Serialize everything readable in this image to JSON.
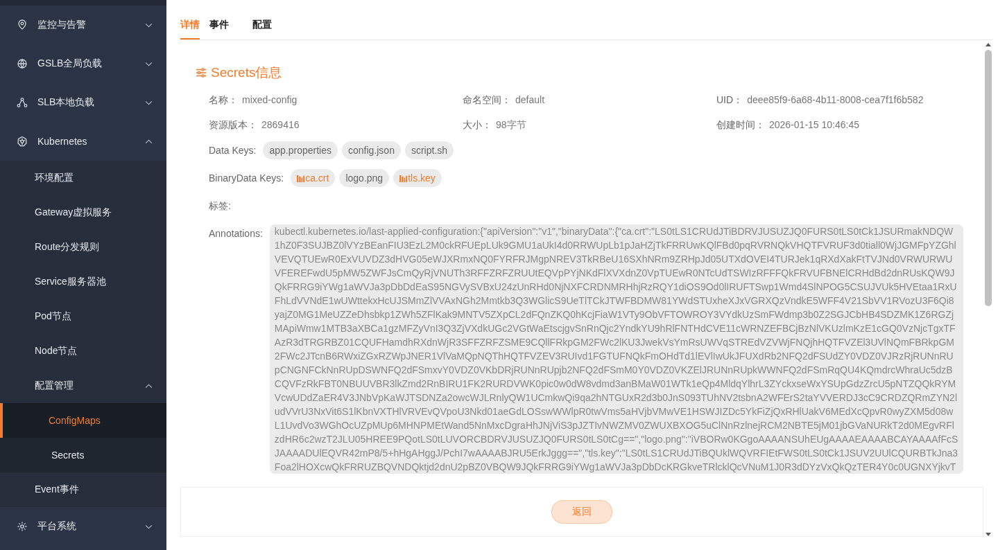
{
  "sidebar": {
    "items": [
      {
        "label": "监控与告警",
        "expanded": false,
        "selected": false
      },
      {
        "label": "GSLB全局负载",
        "expanded": false,
        "selected": false
      },
      {
        "label": "SLB本地负载",
        "expanded": false,
        "selected": false
      },
      {
        "label": "Kubernetes",
        "expanded": true,
        "selected": false,
        "children": [
          {
            "label": "环境配置",
            "selected": false
          },
          {
            "label": "Gateway虚拟服务",
            "selected": false
          },
          {
            "label": "Route分发规则",
            "selected": false
          },
          {
            "label": "Service服务器池",
            "selected": false
          },
          {
            "label": "Pod节点",
            "selected": false
          },
          {
            "label": "Node节点",
            "selected": false
          },
          {
            "label": "配置管理",
            "expanded": true,
            "selected": false,
            "children": [
              {
                "label": "ConfigMaps",
                "selected": true
              },
              {
                "label": "Secrets",
                "selected": false
              }
            ]
          },
          {
            "label": "Event事件",
            "selected": false
          }
        ]
      },
      {
        "label": "平台系统",
        "expanded": false,
        "selected": false
      }
    ]
  },
  "tabs": [
    {
      "label": "详情",
      "selected": true
    },
    {
      "label": "事件",
      "selected": false
    },
    {
      "label": "配置",
      "selected": false
    }
  ],
  "section_title": "Secrets信息",
  "fields": [
    {
      "label": "名称：",
      "value": "mixed-config"
    },
    {
      "label": "命名空间：",
      "value": "default"
    },
    {
      "label": "UID：",
      "value": "deee85f9-6a68-4b11-8008-cea7f1f6b582"
    },
    {
      "label": "资源版本：",
      "value": "2869416"
    },
    {
      "label": "大小：",
      "value": "98字节"
    },
    {
      "label": "创建时间：",
      "value": "2026-01-15 10:46:45"
    }
  ],
  "data_keys": {
    "label": "Data Keys:",
    "tags": [
      {
        "label": "app.properties",
        "kind": "plain"
      },
      {
        "label": "config.json",
        "kind": "plain"
      },
      {
        "label": "script.sh",
        "kind": "plain"
      }
    ]
  },
  "binary_data_keys": {
    "label": "BinaryData Keys:",
    "tags": [
      {
        "label": "ca.crt",
        "kind": "binary"
      },
      {
        "label": "logo.png",
        "kind": "plain"
      },
      {
        "label": "tls.key",
        "kind": "binary"
      }
    ]
  },
  "labels": {
    "label": "标签:"
  },
  "annotations": {
    "label": "Annotations:",
    "value": "kubectl.kubernetes.io/last-applied-configuration:{\"apiVersion\":\"v1\",\"binaryData\":{\"ca.crt\":\"LS0tLS1CRUdJTiBDRVJUSUZJQ0FURS0tLS0tCk1JSURmakNDQW1hZ0F3SUJBZ0lVYzBEanFIU3EzL2M0ckRFUEpLUk9GMU1aUkI4d0RRWUpLb1pJaHZjTkFRRUwKQlFBd0pqRVRNQkVHQTFVRUF3d0tiall0WjJGMFpYZGhlVEVQTUEwR0ExVUVDZ3dHVG05eWJXRmxNQ0FYRFRJMgpNREV3TkRBeU16SXhNRm9ZRHpJd05UTXdOVEI4TURJek1qRXdXakFtTVJNd0VRWURWUVFEREFwdU5pMW5ZWFJsCmQyRjVNUTh3RFFZRFZRUUtEQVpPYjNKdFlXVXdnZ0VpTUEwR0NTcUdTSWIzRFFFQkFRVUFBNElCRHdBd2dnRUsKQW9JQkFRRG9iYWg1aWVJa3pDbDdEaS95NGVySVBxU24zUnRHd0NjNXFCRDNMRHhjRzRQY1diOS9Od0lIRUFTSwp1Wmd4SlNPOG5CSUJVUk5HVEtaa1RxUFhLdVVNdE1wUWttekxHcUJSMmZlVVAxNGh2Mmtkb3Q3WGlicS9UeTlTCkJTWFBDMW81YWdSTUxheXJxVGRXQzVndkE5WFF4V21SbVV1RVozU3F6Qi8yajZ0MG1MeUZZeDhsbkp1ZWh5ZFlKak9MNTV5ZXpCL2dFQnZKQ0hKcjFiaW1VTy9ObVFTOWROY3VYdkUzSmFWdmp3b0Z2SGJCbHB4SDZMK1Z6RGZjMApiWmw1MTB3aXBCa1gzMFZyVnI3Q3ZjVXdkUGc2VGtWaEtscjgvSnRnQjc2YndkYU9hRlFNTHdCVE11cWRNZEFBCjBzNlVKUzlmKzE1cGQ0VzNjcTgxTFAzR3dTRGRBZ01CQUFHamdhRXdnWjR3SFFZRFZSME9CQllFRkpGM2FWc2lKU3JwekVsYmRsUWVqSTREdVZVWjFNQjhHQTFVZEl3UVlNQmFBRkpGM2FWc2JTcnB6RWxiZGxRZWpJNER1VlVaMQpNQThHQTFVZEV3RUIvd1FGTUFNQkFmOHdTd1lEVlIwUkJFUXdRb2NFQ2dFSUdZY0VDZ0VJRzRjRUNnRUpCNGNFCkNnRUpDSWNFQ2dFSmxvY0VDZ0VKbDRjRUNnRUpjb2NFQ2dFSmM0Y0VDZ0VKZElJRUNnRUpkWWNFQ2dFSmRqQU4KQmdrcWhraUc5dzBCQVFzRkFBT0NBUUVBR3lkZmd2RnBIRU1FK2RURDVWK0pic0w0dW8vdmd3anBMaW01WTk1eQp4MldqYlhrL3ZYckxseWxYSUpGdzZrcU5pNTZQQkRYMVcwUDdZaER4V3JNbVpKaWJTSDNZa2owcWJLRnlyQW1UCmkwQi9qa2hNTGUxR2d3b0JnS093TUhNV2tsbnA2WFErS2taYVVERDJ3cC9CRDZQRmZYN2ludVVrU3NxVit6S1lKbnVXTHlVRVEvQVpoU3Nkd01aeGdLOSswWWlpR0twVms5aHVjbVMwVE1HSWJIZDc5YkFiZjQxRHlUakV6MEdXcQpvR0wyZXM5d08wL1UvdVo3WGhOcUZpMUp6MHNPMEtWand5NnMxcDgraHhJNjViS3pJZTIvNWZMV0ZWUXBXOG5uClNnRzlnejRCM2NBTE5jM01jbGVaNURkT2d0MEgvRFlzdHR6c2wzT2JLU05HREE9PQotLS0tLUVORCBDRVJUSUZJQ0FURS0tLS0tCg==\",\"logo.png\":\"iVBORw0KGgoAAAANSUhEUgAAAAEAAAABCAYAAAAfFcSJAAAADUlEQVR42mP8/5+hHgAHggJ/PchI7wAAAABJRU5ErkJggg==\",\"tls.key\":\"LS0tLS1CRUdJTiBQUklWQVRFIEtFWS0tLS0tCk1JSUV2UUlCQURBTkJna3Foa2lHOXcwQkFRRUZBQVNDQktjd2dnU2pBZ0VBQW9JQkFRRG9iYWg1aWVJa3pDbDcKRGkveTRlcklQcVNuM1J0R3dDYzVxQkQzTER4Y0c0UGNXYjkvT"
  },
  "footer": {
    "button": "返回"
  }
}
